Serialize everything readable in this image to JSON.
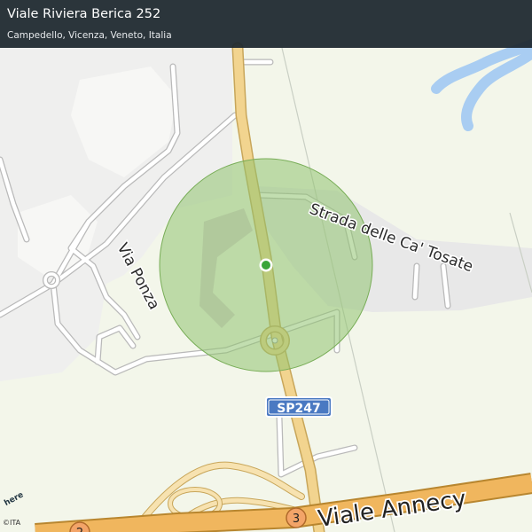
{
  "header": {
    "title": "Viale Riviera Berica 252",
    "subtitle": "Campedello, Vicenza, Veneto, Italia"
  },
  "map": {
    "street_labels": {
      "ca_tosate": "Strada delle  Ca' Tosate",
      "via_ponza": "Via Ponza",
      "viale_annecy": "Viale  Annecy"
    },
    "road_shield": "SP247",
    "junction_markers": [
      "3",
      "2"
    ],
    "accuracy_circle_color": "#8fc26f",
    "location_dot_color": "#3aa53a",
    "river_color": "#a9cdf2",
    "major_road_color": "#f2d48f",
    "attribution": "©ITA",
    "logo_text": "here"
  }
}
